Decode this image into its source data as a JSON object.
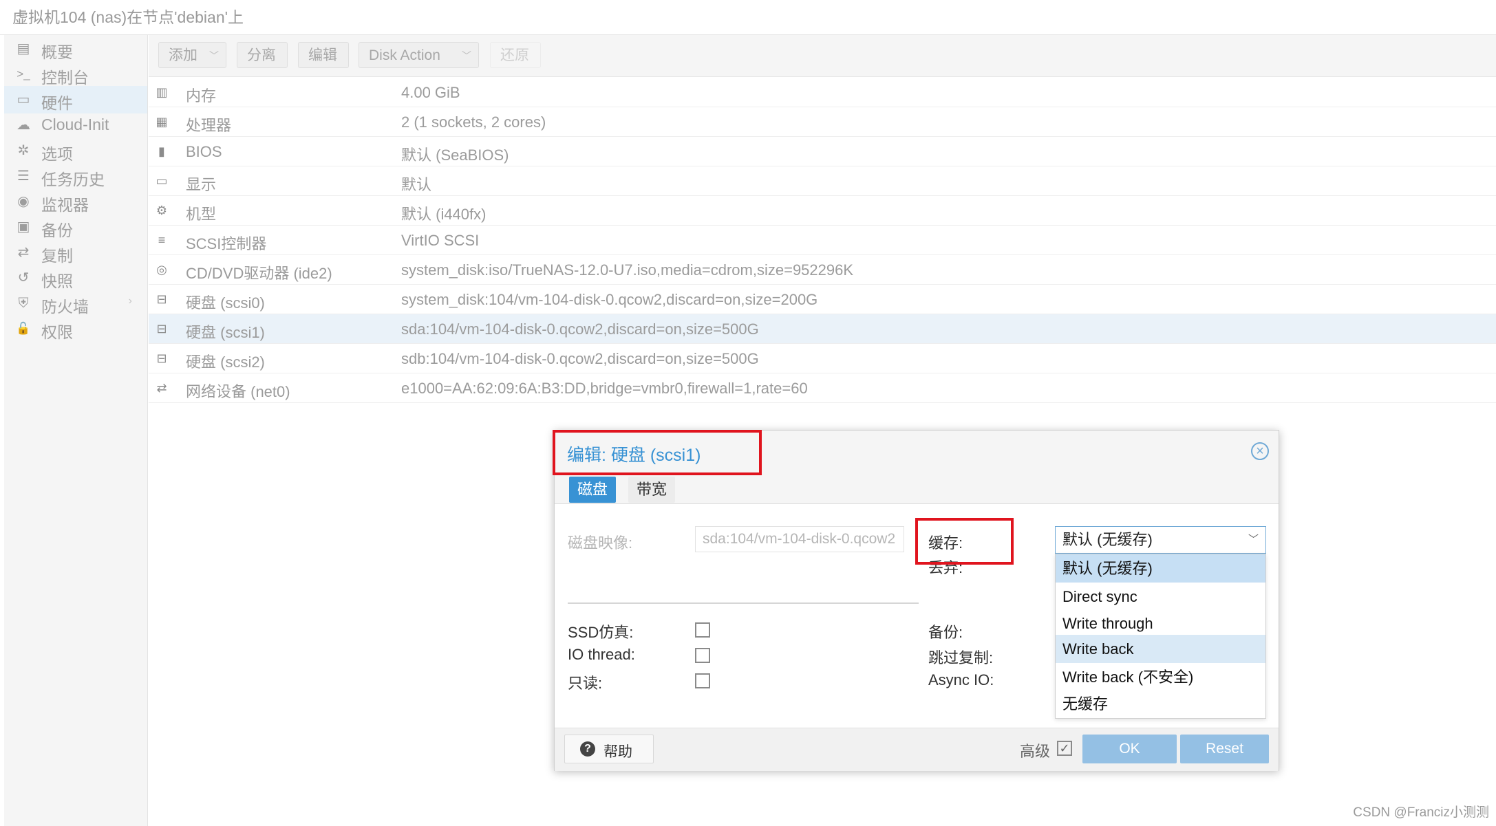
{
  "window": {
    "title": "虚拟机104 (nas)在节点'debian'上"
  },
  "sidebar": {
    "items": [
      {
        "label": "概要",
        "icon": "book-icon",
        "glyph": "▤"
      },
      {
        "label": "控制台",
        "icon": "terminal-icon",
        "glyph": ">_"
      },
      {
        "label": "硬件",
        "icon": "monitor-icon",
        "glyph": "▭"
      },
      {
        "label": "Cloud-Init",
        "icon": "cloud-icon",
        "glyph": "☁"
      },
      {
        "label": "选项",
        "icon": "gear-icon",
        "glyph": "✲"
      },
      {
        "label": "任务历史",
        "icon": "list-icon",
        "glyph": "☰"
      },
      {
        "label": "监视器",
        "icon": "eye-icon",
        "glyph": "◉"
      },
      {
        "label": "备份",
        "icon": "floppy-icon",
        "glyph": "▣"
      },
      {
        "label": "复制",
        "icon": "retweet-icon",
        "glyph": "⇄"
      },
      {
        "label": "快照",
        "icon": "history-icon",
        "glyph": "↺"
      },
      {
        "label": "防火墙",
        "icon": "shield-icon",
        "glyph": "⛨",
        "arrow": "›"
      },
      {
        "label": "权限",
        "icon": "unlock-icon",
        "glyph": "🔓"
      }
    ],
    "selected": "硬件"
  },
  "toolbar": {
    "add_label": "添加",
    "detach_label": "分离",
    "edit_label": "编辑",
    "disk_action_label": "Disk Action",
    "revert_label": "还原",
    "chevron": "﹀"
  },
  "hardware": {
    "rows": [
      {
        "name": "内存",
        "value": "4.00 GiB",
        "icon": "memory-icon",
        "glyph": "▥"
      },
      {
        "name": "处理器",
        "value": "2 (1 sockets, 2 cores)",
        "icon": "cpu-icon",
        "glyph": "▦"
      },
      {
        "name": "BIOS",
        "value": "默认 (SeaBIOS)",
        "icon": "chip-icon",
        "glyph": "▮"
      },
      {
        "name": "显示",
        "value": "默认",
        "icon": "desktop-icon",
        "glyph": "▭"
      },
      {
        "name": "机型",
        "value": "默认 (i440fx)",
        "icon": "cogs-icon",
        "glyph": "⚙"
      },
      {
        "name": "SCSI控制器",
        "value": "VirtIO SCSI",
        "icon": "database-icon",
        "glyph": "≡"
      },
      {
        "name": "CD/DVD驱动器 (ide2)",
        "value": "system_disk:iso/TrueNAS-12.0-U7.iso,media=cdrom,size=952296K",
        "icon": "cdrom-icon",
        "glyph": "◎"
      },
      {
        "name": "硬盘 (scsi0)",
        "value": "system_disk:104/vm-104-disk-0.qcow2,discard=on,size=200G",
        "icon": "hdd-icon",
        "glyph": "⊟"
      },
      {
        "name": "硬盘 (scsi1)",
        "value": "sda:104/vm-104-disk-0.qcow2,discard=on,size=500G",
        "icon": "hdd-icon",
        "glyph": "⊟"
      },
      {
        "name": "硬盘 (scsi2)",
        "value": "sdb:104/vm-104-disk-0.qcow2,discard=on,size=500G",
        "icon": "hdd-icon",
        "glyph": "⊟"
      },
      {
        "name": "网络设备 (net0)",
        "value": "e1000=AA:62:09:6A:B3:DD,bridge=vmbr0,firewall=1,rate=60",
        "icon": "exchange-icon",
        "glyph": "⇄"
      }
    ],
    "selected_row": "硬盘 (scsi1)"
  },
  "dialog": {
    "title": "编辑: 硬盘 (scsi1)",
    "close_glyph": "×",
    "tabs": [
      "磁盘",
      "带宽"
    ],
    "active_tab": "磁盘",
    "fields": {
      "disk_image_label": "磁盘映像:",
      "disk_image_value": "sda:104/vm-104-disk-0.qcow2",
      "cache_label": "缓存:",
      "discard_label": "丢弃:",
      "ssd_label": "SSD仿真:",
      "iothread_label": "IO thread:",
      "readonly_label": "只读:",
      "backup_label": "备份:",
      "skip_replication_label": "跳过复制:",
      "async_io_label": "Async IO:"
    },
    "cache_select": {
      "value": "默认 (无缓存)",
      "options": [
        "默认 (无缓存)",
        "Direct sync",
        "Write through",
        "Write back",
        "Write back (不安全)",
        "无缓存"
      ],
      "selected_option": "默认 (无缓存)",
      "hovered_option": "Write back"
    },
    "footer": {
      "help_label": "帮助",
      "help_glyph": "?",
      "advanced_label": "高级",
      "advanced_checked": true,
      "check_glyph": "✓",
      "ok_label": "OK",
      "reset_label": "Reset"
    }
  },
  "annotations": {
    "highlight_color": "#e0141e"
  },
  "watermark": "CSDN @Franciz小测测",
  "colors": {
    "accent": "#3892d4",
    "selection": "#eaf2f9",
    "button_disabled": "#94c0e4"
  }
}
